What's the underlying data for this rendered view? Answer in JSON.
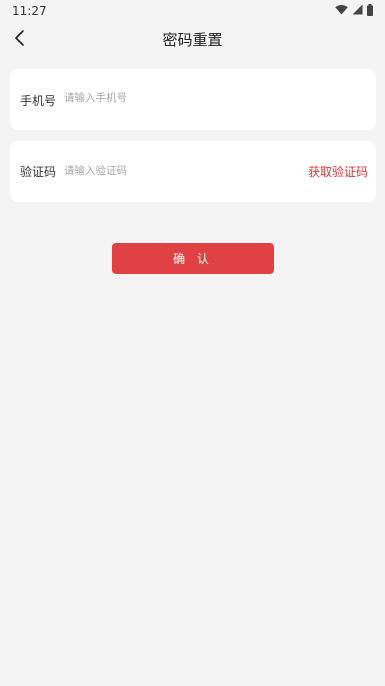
{
  "status_bar": {
    "time": "11:27",
    "icons": [
      "wifi-icon",
      "signal-icon",
      "battery-icon"
    ]
  },
  "nav": {
    "back_icon": "chevron-left-icon",
    "title": "密码重置"
  },
  "form": {
    "phone": {
      "label": "手机号",
      "placeholder": "请输入手机号",
      "value": ""
    },
    "code": {
      "label": "验证码",
      "placeholder": "请输入验证码",
      "value": "",
      "get_code_label": "获取验证码"
    }
  },
  "confirm_label": "确 认",
  "colors": {
    "background": "#f4f4f4",
    "card": "#ffffff",
    "accent": "#e04142",
    "link": "#d9353b"
  }
}
